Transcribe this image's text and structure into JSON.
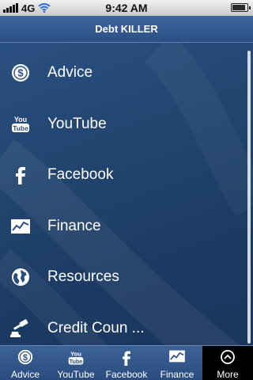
{
  "status_bar": {
    "network": "4G",
    "time": "9:42 AM",
    "battery_level": 0.9
  },
  "nav": {
    "title": "Debt KILLER"
  },
  "list": {
    "items": [
      {
        "label": "Advice",
        "icon": "dollar-coin-icon"
      },
      {
        "label": "YouTube",
        "icon": "youtube-icon"
      },
      {
        "label": "Facebook",
        "icon": "facebook-icon"
      },
      {
        "label": "Finance",
        "icon": "chart-icon"
      },
      {
        "label": "Resources",
        "icon": "globe-icon"
      },
      {
        "label": "Credit Coun ...",
        "icon": "gavel-icon"
      }
    ]
  },
  "tabbar": {
    "tabs": [
      {
        "label": "Advice",
        "icon": "dollar-coin-icon"
      },
      {
        "label": "YouTube",
        "icon": "youtube-icon"
      },
      {
        "label": "Facebook",
        "icon": "facebook-icon"
      },
      {
        "label": "Finance",
        "icon": "chart-icon"
      },
      {
        "label": "More",
        "icon": "more-icon",
        "selected": true
      }
    ]
  },
  "colors": {
    "background": "#22456f",
    "navbar": "#2b4f84",
    "selected_tab": "#000000",
    "text": "#ffffff"
  }
}
